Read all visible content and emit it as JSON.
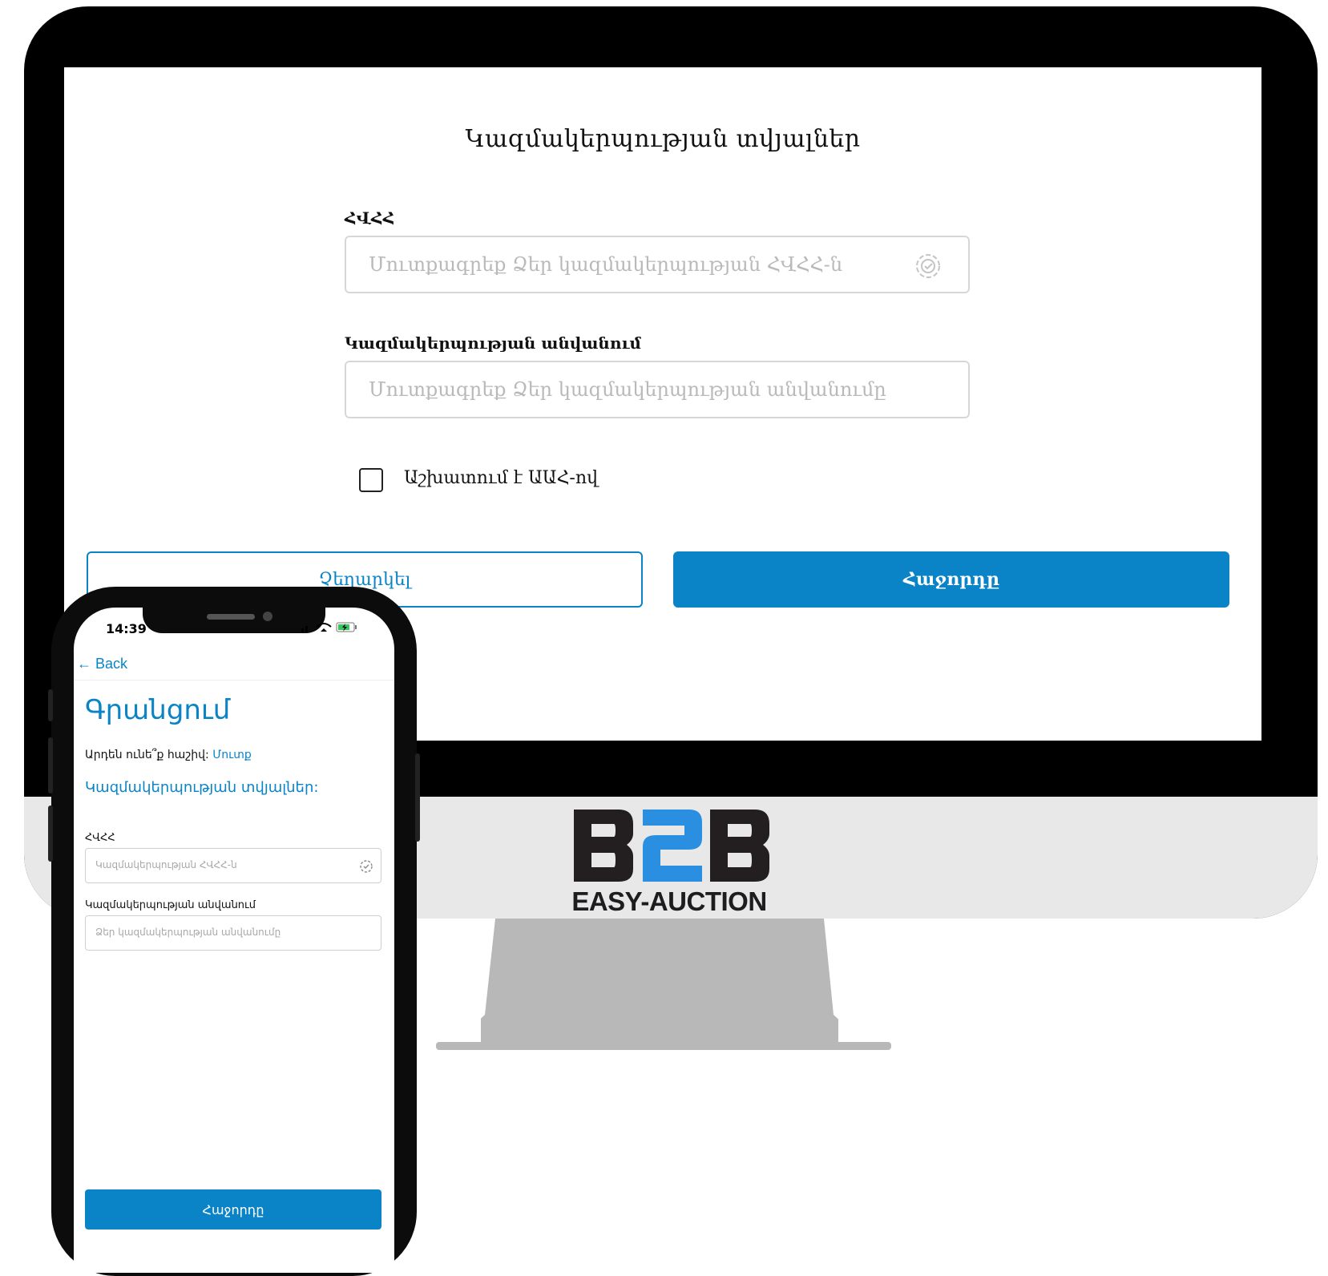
{
  "desktop": {
    "title": "Կազմակերպության տվյալներ",
    "tin_label": "ՀՎՀՀ",
    "tin_placeholder": "Մուտքագրեք Ձեր կազմակերպության ՀՎՀՀ-ն",
    "name_label": "Կազմակերպության անվանում",
    "name_placeholder": "Մուտքագրեք Ձեր կազմակերպության անվանումը",
    "vat_checkbox_label": "Աշխատում է ԱԱՀ-ով",
    "cancel_label": "Չեղարկել",
    "next_label": "Հաջորդը"
  },
  "logo": {
    "text": "EASY-AUCTION",
    "dark_color": "#231f20",
    "accent_color": "#2a8fe0"
  },
  "phone": {
    "time": "14:39",
    "back_label": "Back",
    "title": "Գրանցում",
    "have_account_text": "Արդեն ունե՞ք հաշիվ:",
    "login_link": "Մուտք",
    "section_title": "Կազմակերպության տվյալներ:",
    "tin_label": "ՀՎՀՀ",
    "tin_placeholder": "Կազմակերպության ՀՎՀՀ-ն",
    "name_label": "Կազմակերպության անվանում",
    "name_placeholder": "Ձեր կազմակերպության անվանումը",
    "next_label": "Հաջորդը"
  },
  "colors": {
    "accent": "#0a84c6",
    "bezel": "#000000",
    "chin": "#e8e8e8",
    "stand": "#b8b8b8"
  }
}
